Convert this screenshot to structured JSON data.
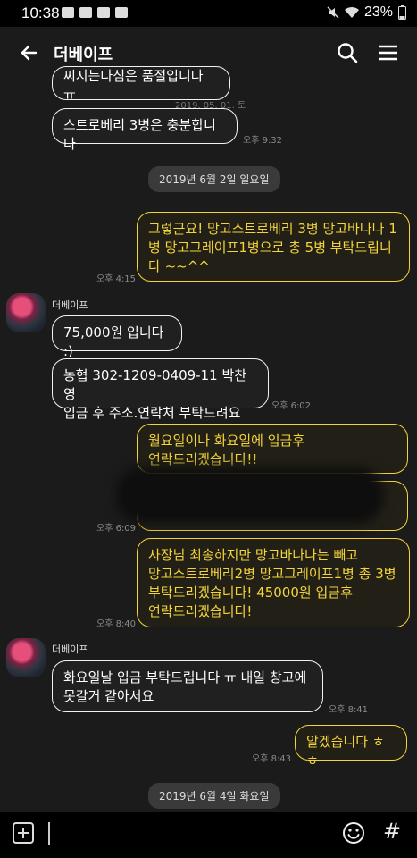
{
  "status": {
    "time": "10:38",
    "battery": "23%"
  },
  "header": {
    "title": "더베이프"
  },
  "messages": {
    "m0_text": "씨지는다심은 품절입니다 ㅠ",
    "m0_date": "2019. 05. 01. 토",
    "m1_text": "스트로베리 3병은 충분합니다",
    "m1_time": "오후 9:32",
    "date1": "2019년 6월 2일 일요일",
    "m2_text": "그렇군요! 망고스트로베리 3병 망고바나나 1병 망고그레이프1병으로 총 5병 부탁드립니다 ~~^^",
    "m2_time": "오후 4:15",
    "sender1": "더베이프",
    "m3_text": "75,000원 입니다 :)",
    "m4_text": "농협 302-1209-0409-11 박찬영\n입금 후 주소.연락처 부탁드려요",
    "m4_time": "오후 6:02",
    "m5_text": "월요일이나 화요일에 입금후\n연락드리겠습니다!!",
    "m6_time": "오후 6:09",
    "m7_text": "사장님 최송하지만 망고바나나는 빼고\n망고스트로베리2병 망고그레이프1병 총 3병\n부탁드리겠습니다! 45000원 입금후\n연락드리겠습니다!",
    "m7_time": "오후 8:40",
    "sender2": "더베이프",
    "m8_text": "화요일날 입금 부탁드립니다 ㅠ 내일 창고에\n못갈거 같아서요",
    "m8_time": "오후 8:41",
    "m9_text": "알겠습니다 ㅎㅎ",
    "m9_time": "오후 8:43",
    "date2": "2019년 6월 4일 화요일"
  },
  "colors": {
    "accent": "#f3d43a",
    "background": "#1b1b1b"
  },
  "icons": [
    "back-arrow-icon",
    "search-icon",
    "hamburger-menu-icon",
    "plus-icon",
    "emoji-icon",
    "hash-icon"
  ]
}
